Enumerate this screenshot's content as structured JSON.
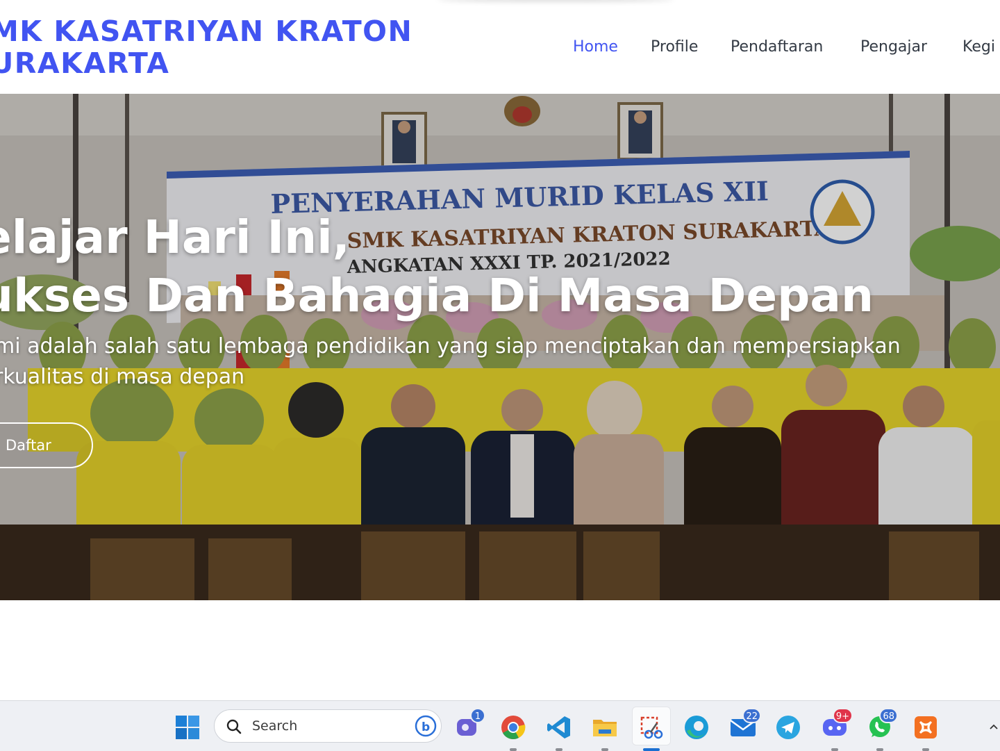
{
  "header": {
    "brand_line1": "MK KASATRIYAN KRATON",
    "brand_line2": "URAKARTA",
    "brand_color": "#4154f1",
    "nav": [
      {
        "label": "Home",
        "active": true
      },
      {
        "label": "Profile",
        "active": false
      },
      {
        "label": "Pendaftaran",
        "active": false
      },
      {
        "label": "Pengajar",
        "active": false
      },
      {
        "label": "Kegi",
        "active": false
      }
    ]
  },
  "hero": {
    "banner_line1": "PENYERAHAN MURID KELAS XII",
    "banner_line2": "SMK KASATRIYAN KRATON SURAKARTA",
    "banner_line3": "ANGKATAN XXXI TP. 2021/2022",
    "title_line1": "elajar Hari Ini,",
    "title_line2": "ukses Dan Bahagia Di Masa Depan",
    "subtitle_line1": "mi adalah salah satu lembaga pendidikan yang siap menciptakan dan mempersiapkan",
    "subtitle_line2": "rkualitas di masa depan",
    "button_label": "Daftar"
  },
  "taskbar": {
    "search_placeholder": "Search",
    "apps": [
      {
        "name": "start-icon"
      },
      {
        "name": "teams-icon",
        "badge": "1"
      },
      {
        "name": "chrome-icon"
      },
      {
        "name": "vscode-icon"
      },
      {
        "name": "file-explorer-icon"
      },
      {
        "name": "snipping-tool-icon"
      },
      {
        "name": "edge-icon"
      },
      {
        "name": "mail-icon",
        "badge": "22"
      },
      {
        "name": "telegram-icon"
      },
      {
        "name": "discord-icon",
        "badge": "9+"
      },
      {
        "name": "whatsapp-icon",
        "badge": "68"
      },
      {
        "name": "xampp-icon"
      }
    ]
  }
}
